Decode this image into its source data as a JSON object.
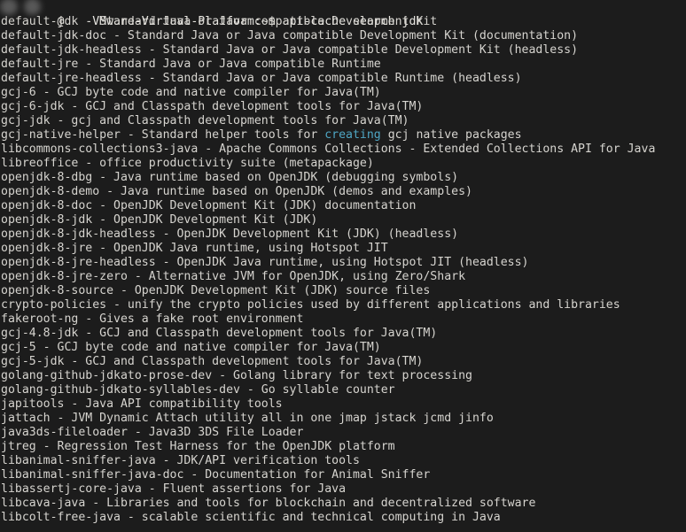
{
  "terminal": {
    "app": "Terminal",
    "background_color": "#1c1c1c",
    "foreground_color": "#d6d4cf",
    "highlight_color": "#4fa6c4",
    "columns": 96,
    "rows": 38,
    "prompt": {
      "user_redacted": true,
      "host_redacted": true,
      "at_symbol": "@",
      "hostname_suffix": "-VMware-Virtual-Platform",
      "separator": ":",
      "path": "~",
      "sigil": "$",
      "command": "apt-cache search jdk",
      "full_visible_text": "  @   -VMware-Virtual-Platform:~$ apt-cache search jdk"
    },
    "output_lines": [
      "default-jdk - Standard Java or Java compatible Development Kit",
      "default-jdk-doc - Standard Java or Java compatible Development Kit (documentation)",
      "default-jdk-headless - Standard Java or Java compatible Development Kit (headless)",
      "default-jre - Standard Java or Java compatible Runtime",
      "default-jre-headless - Standard Java or Java compatible Runtime (headless)",
      "gcj-6 - GCJ byte code and native compiler for Java(TM)",
      "gcj-6-jdk - GCJ and Classpath development tools for Java(TM)",
      "gcj-jdk - gcj and Classpath development tools for Java(TM)",
      "libcommons-collections3-java - Apache Commons Collections - Extended Collections API for Java",
      "libreoffice - office productivity suite (metapackage)",
      "openjdk-8-dbg - Java runtime based on OpenJDK (debugging symbols)",
      "openjdk-8-demo - Java runtime based on OpenJDK (demos and examples)",
      "openjdk-8-doc - OpenJDK Development Kit (JDK) documentation",
      "openjdk-8-jdk - OpenJDK Development Kit (JDK)",
      "openjdk-8-jdk-headless - OpenJDK Development Kit (JDK) (headless)",
      "openjdk-8-jre - OpenJDK Java runtime, using Hotspot JIT",
      "openjdk-8-jre-headless - OpenJDK Java runtime, using Hotspot JIT (headless)",
      "openjdk-8-jre-zero - Alternative JVM for OpenJDK, using Zero/Shark",
      "openjdk-8-source - OpenJDK Development Kit (JDK) source files",
      "crypto-policies - unify the crypto policies used by different applications and libraries",
      "fakeroot-ng - Gives a fake root environment",
      "gcj-4.8-jdk - GCJ and Classpath development tools for Java(TM)",
      "gcj-5 - GCJ byte code and native compiler for Java(TM)",
      "gcj-5-jdk - GCJ and Classpath development tools for Java(TM)",
      "golang-github-jdkato-prose-dev - Golang library for text processing",
      "golang-github-jdkato-syllables-dev - Go syllable counter",
      "japitools - Java API compatibility tools",
      "jattach - JVM Dynamic Attach utility all in one jmap jstack jcmd jinfo",
      "java3ds-fileloader - Java3D 3DS File Loader",
      "jtreg - Regression Test Harness for the OpenJDK platform",
      "libanimal-sniffer-java - JDK/API verification tools",
      "libanimal-sniffer-java-doc - Documentation for Animal Sniffer",
      "libassertj-core-java - Fluent assertions for Java",
      "libcava-java - Libraries and tools for blockchain and decentralized software",
      "libcolt-free-java - scalable scientific and technical computing in Java"
    ],
    "highlighted_line": {
      "index": 8,
      "prefix": "gcj-native-helper - Standard helper tools for ",
      "keyword": "creating",
      "suffix": " gcj native packages"
    }
  }
}
